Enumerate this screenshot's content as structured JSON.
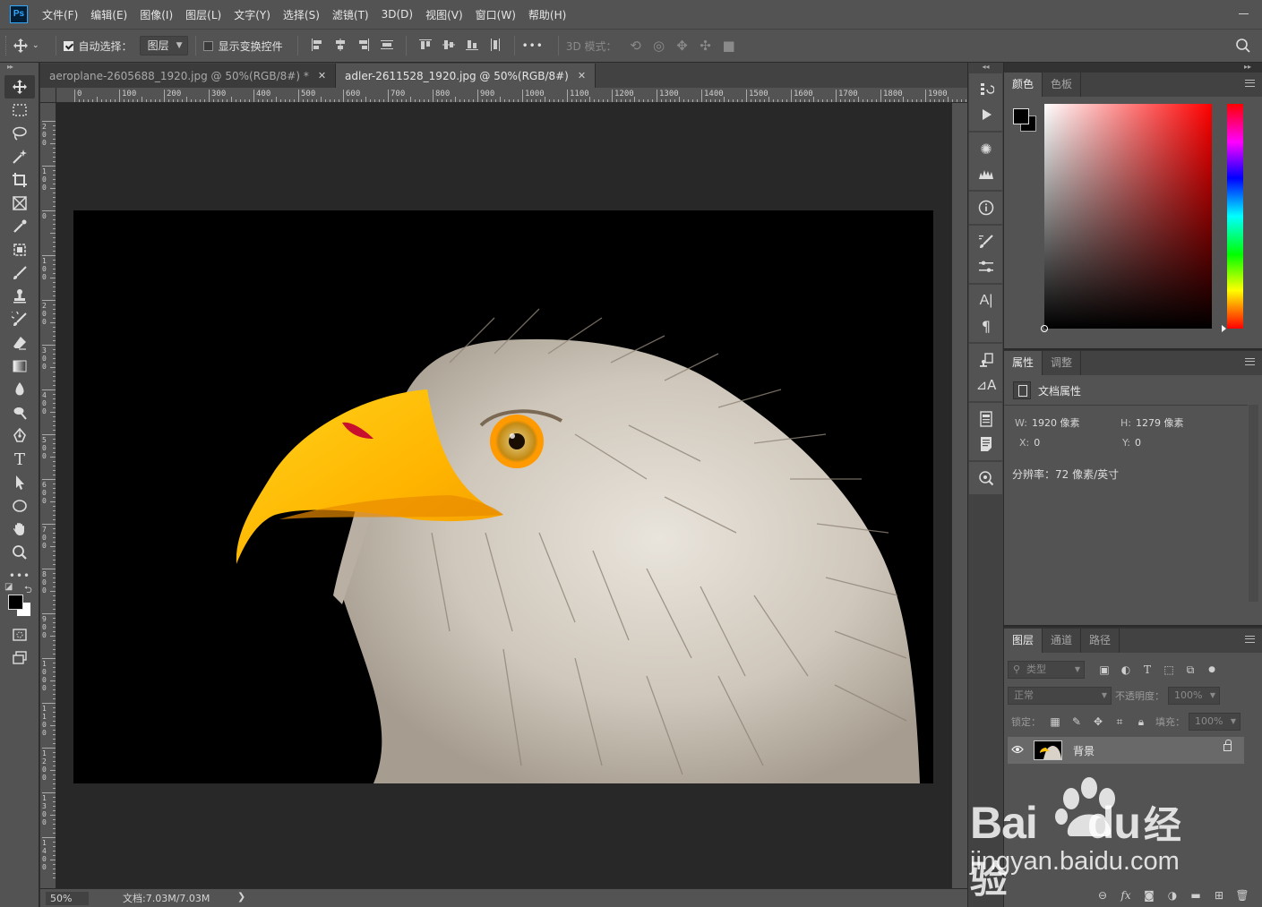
{
  "app": {
    "logo_text": "Ps"
  },
  "menu": [
    "文件(F)",
    "编辑(E)",
    "图像(I)",
    "图层(L)",
    "文字(Y)",
    "选择(S)",
    "滤镜(T)",
    "3D(D)",
    "视图(V)",
    "窗口(W)",
    "帮助(H)"
  ],
  "options": {
    "auto_select_label": "自动选择：",
    "auto_select_checked": true,
    "auto_select_target": "图层",
    "show_transform_label": "显示变换控件",
    "show_transform_checked": false,
    "more_label": "•••",
    "mode_3d_label": "3D 模式："
  },
  "doc_tabs": [
    {
      "title": "aeroplane-2605688_1920.jpg @ 50%(RGB/8#) *",
      "active": false
    },
    {
      "title": "adler-2611528_1920.jpg @ 50%(RGB/8#)",
      "active": true
    }
  ],
  "ruler_h_ticks": [
    "0",
    "100",
    "200",
    "300",
    "400",
    "500",
    "600",
    "700",
    "800",
    "900",
    "1000",
    "1100",
    "1200",
    "1300",
    "1400",
    "1500",
    "1600",
    "1700",
    "1800",
    "1900"
  ],
  "ruler_v_ticks": [
    "200",
    "100",
    "0",
    "100",
    "200",
    "300",
    "400",
    "500",
    "600",
    "700",
    "800",
    "900",
    "1000",
    "1100",
    "1200",
    "1300",
    "1400"
  ],
  "status": {
    "zoom": "50%",
    "doc_info": "文档:7.03M/7.03M",
    "arrow": "❯"
  },
  "color_panel": {
    "tabs": [
      "颜色",
      "色板"
    ],
    "foreground": "#000000",
    "background": "#000000",
    "hue": "#ff0000"
  },
  "properties_panel": {
    "tabs": [
      "属性",
      "调整"
    ],
    "doc_label": "文档属性",
    "width_key": "W:",
    "width_value": "1920 像素",
    "height_key": "H:",
    "height_value": "1279 像素",
    "x_key": "X:",
    "x_value": "0",
    "y_key": "Y:",
    "y_value": "0",
    "resolution": "分辨率：72 像素/英寸"
  },
  "layers_panel": {
    "tabs": [
      "图层",
      "通道",
      "路径"
    ],
    "filter_placeholder": "类型",
    "blend_mode": "正常",
    "opacity_label": "不透明度：",
    "opacity_value": "100%",
    "lock_label": "锁定：",
    "fill_label": "填充：",
    "fill_value": "100%",
    "layers": [
      {
        "name": "背景",
        "visible": true,
        "locked": true
      }
    ]
  },
  "toolbar_tools": [
    "move",
    "marquee",
    "lasso",
    "magic-wand",
    "crop",
    "frame",
    "eyedropper",
    "healing",
    "brush",
    "stamp",
    "history-brush",
    "eraser",
    "gradient",
    "blur",
    "dodge",
    "pen",
    "type",
    "path-select",
    "shape",
    "hand",
    "zoom",
    "more"
  ],
  "watermark": {
    "main": "Bai",
    "paw": "du",
    "cn": "经验",
    "sub": "jingyan.baidu.com"
  }
}
